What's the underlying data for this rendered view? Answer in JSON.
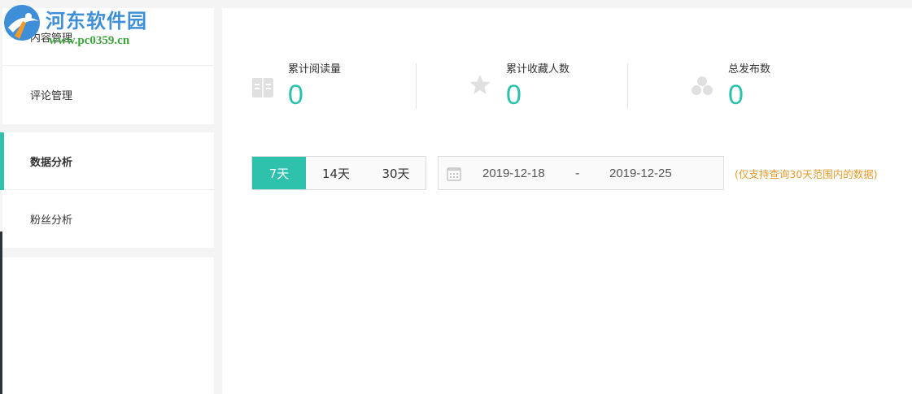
{
  "watermark": {
    "title": "河东软件园",
    "url": "www.pc0359.cn"
  },
  "sidebar": {
    "items": [
      {
        "label": "内容管理"
      },
      {
        "label": "评论管理"
      },
      {
        "label": "数据分析",
        "active": true
      },
      {
        "label": "粉丝分析"
      }
    ]
  },
  "stats": [
    {
      "label": "累计阅读量",
      "value": "0",
      "icon": "book-icon"
    },
    {
      "label": "累计收藏人数",
      "value": "0",
      "icon": "star-icon"
    },
    {
      "label": "总发布数",
      "value": "0",
      "icon": "cluster-icon"
    }
  ],
  "range_tabs": [
    {
      "label": "7天",
      "selected": true
    },
    {
      "label": "14天"
    },
    {
      "label": "30天"
    }
  ],
  "date_range": {
    "start": "2019-12-18",
    "separator": "-",
    "end": "2019-12-25"
  },
  "note": "(仅支持查询30天范围内的数据)",
  "colors": {
    "accent": "#2ec1ac",
    "note": "#e39a2b",
    "watermark_blue": "#3f8fd8",
    "watermark_green": "#3aa33a"
  }
}
